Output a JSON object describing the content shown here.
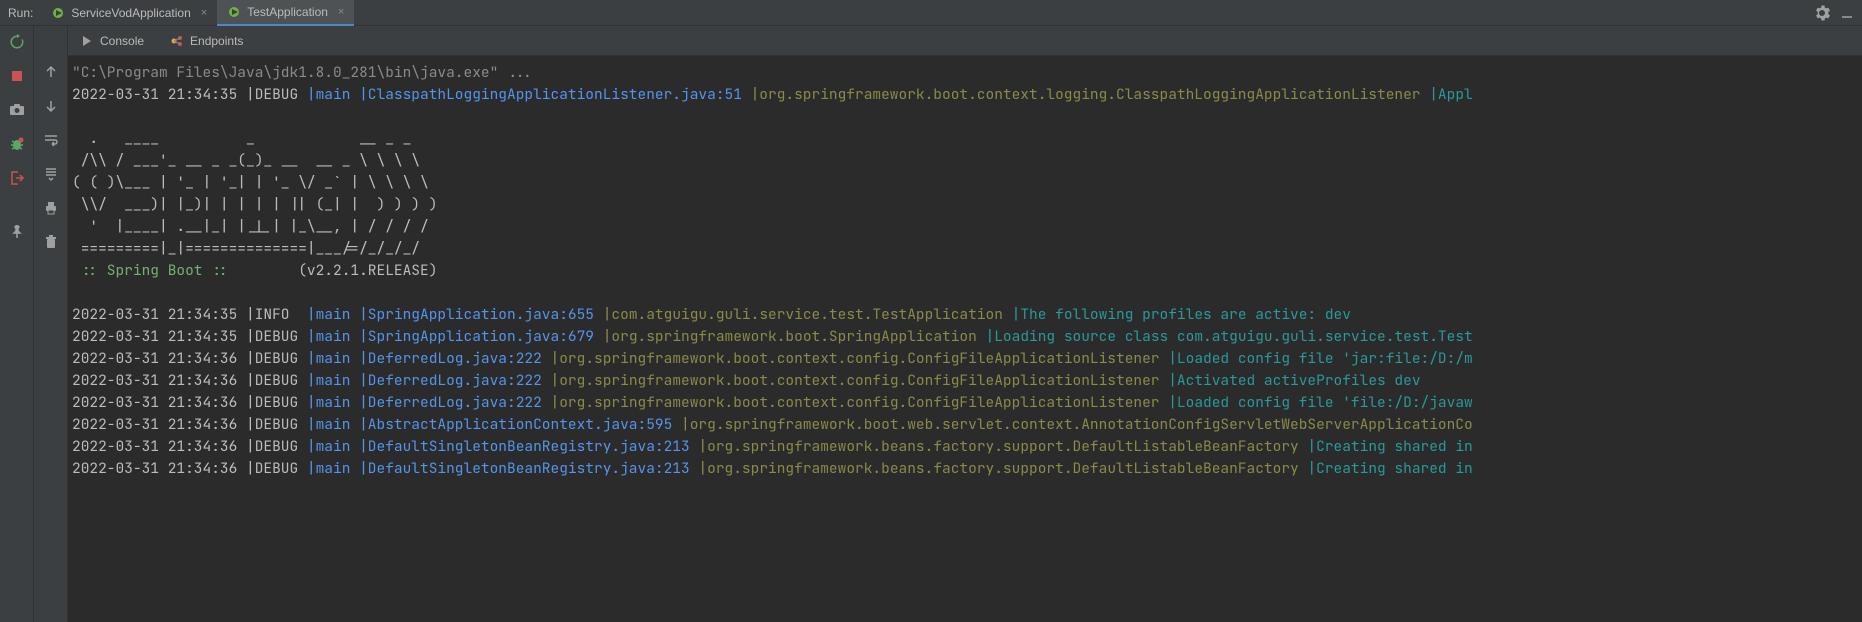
{
  "topBar": {
    "runLabel": "Run:",
    "tabs": [
      {
        "label": "ServiceVodApplication",
        "active": false
      },
      {
        "label": "TestApplication",
        "active": true
      }
    ]
  },
  "subTabs": {
    "console": "Console",
    "endpoints": "Endpoints"
  },
  "console": {
    "cmdLine": "\"C:\\Program Files\\Java\\jdk1.8.0_281\\bin\\java.exe\" ...",
    "firstLog": {
      "ts": "2022-03-31 21:34:35 ",
      "level": "|DEBUG ",
      "thread": "|main ",
      "loc": "|ClasspathLoggingApplicationListener.java:51 ",
      "logger": "|org.springframework.boot.context.logging.ClasspathLoggingApplicationListener ",
      "msg": "|Appl"
    },
    "banner": [
      "  .   ____          _            __ _ _",
      " /\\\\ / ___'_ __ _ _(_)_ __  __ _ \\ \\ \\ \\",
      "( ( )\\___ | '_ | '_| | '_ \\/ _` | \\ \\ \\ \\",
      " \\\\/  ___)| |_)| | | | | || (_| |  ) ) ) )",
      "  '  |____| .__|_| |_|_| |_\\__, | / / / /",
      " =========|_|==============|___/=/_/_/_/"
    ],
    "springLine": {
      "left": " :: Spring Boot :: ",
      "right": "       (v2.2.1.RELEASE)"
    },
    "logs": [
      {
        "ts": "2022-03-31 21:34:35 ",
        "level": "|INFO  ",
        "thread": "|main ",
        "loc": "|SpringApplication.java:655 ",
        "logger": "|com.atguigu.guli.service.test.TestApplication ",
        "msg": "|The following profiles are active: dev"
      },
      {
        "ts": "2022-03-31 21:34:35 ",
        "level": "|DEBUG ",
        "thread": "|main ",
        "loc": "|SpringApplication.java:679 ",
        "logger": "|org.springframework.boot.SpringApplication ",
        "msg": "|Loading source class com.atguigu.guli.service.test.Test"
      },
      {
        "ts": "2022-03-31 21:34:36 ",
        "level": "|DEBUG ",
        "thread": "|main ",
        "loc": "|DeferredLog.java:222 ",
        "logger": "|org.springframework.boot.context.config.ConfigFileApplicationListener ",
        "msg": "|Loaded config file 'jar:file:/D:/m"
      },
      {
        "ts": "2022-03-31 21:34:36 ",
        "level": "|DEBUG ",
        "thread": "|main ",
        "loc": "|DeferredLog.java:222 ",
        "logger": "|org.springframework.boot.context.config.ConfigFileApplicationListener ",
        "msg": "|Activated activeProfiles dev"
      },
      {
        "ts": "2022-03-31 21:34:36 ",
        "level": "|DEBUG ",
        "thread": "|main ",
        "loc": "|DeferredLog.java:222 ",
        "logger": "|org.springframework.boot.context.config.ConfigFileApplicationListener ",
        "msg": "|Loaded config file 'file:/D:/javaw"
      },
      {
        "ts": "2022-03-31 21:34:36 ",
        "level": "|DEBUG ",
        "thread": "|main ",
        "loc": "|AbstractApplicationContext.java:595 ",
        "logger": "|org.springframework.boot.web.servlet.context.AnnotationConfigServletWebServerApplicationCo",
        "msg": ""
      },
      {
        "ts": "2022-03-31 21:34:36 ",
        "level": "|DEBUG ",
        "thread": "|main ",
        "loc": "|DefaultSingletonBeanRegistry.java:213 ",
        "logger": "|org.springframework.beans.factory.support.DefaultListableBeanFactory ",
        "msg": "|Creating shared in"
      },
      {
        "ts": "2022-03-31 21:34:36 ",
        "level": "|DEBUG ",
        "thread": "|main ",
        "loc": "|DefaultSingletonBeanRegistry.java:213 ",
        "logger": "|org.springframework.beans.factory.support.DefaultListableBeanFactory ",
        "msg": "|Creating shared in"
      }
    ]
  },
  "colors": {
    "bg": "#2b2b2b",
    "panel": "#3c3f41",
    "accent": "#4a88c7",
    "link": "#5394ec",
    "olive": "#8a8a4a",
    "teal": "#299999",
    "green": "#6fb36f"
  }
}
